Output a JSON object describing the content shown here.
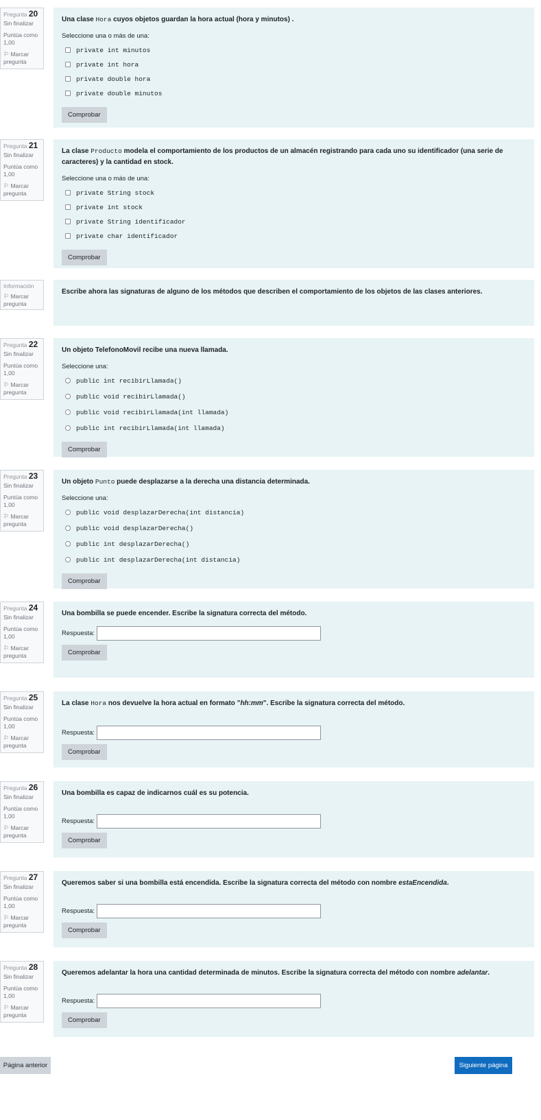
{
  "labels": {
    "pregunta": "Pregunta",
    "sin_finalizar": "Sin finalizar",
    "puntua_como": "Puntúa como",
    "puntos": "1,00",
    "marcar": "Marcar",
    "pregunta_lower": "pregunta",
    "informacion": "Información",
    "seleccione_varias": "Seleccione una o más de una:",
    "seleccione_una": "Seleccione una:",
    "comprobar": "Comprobar",
    "respuesta": "Respuesta:"
  },
  "q20": {
    "number": "20",
    "text_a": "Una clase ",
    "text_code": "Hora",
    "text_b": " cuyos objetos guardan la hora actual (hora y minutos) .",
    "options": [
      "private int minutos",
      "private int hora",
      "private double hora",
      "private double minutos"
    ]
  },
  "q21": {
    "number": "21",
    "text_a": "La clase ",
    "text_code": "Producto",
    "text_b": " modela el comportamiento de los productos de un almacén registrando para cada uno su identificador (una serie de caracteres) y la cantidad en stock.",
    "options": [
      "private String stock",
      "private int stock",
      "private String identificador",
      "private char identificador"
    ]
  },
  "info": {
    "text": "Escribe ahora las signaturas de alguno de los métodos que describen el comportamiento de los objetos de las clases anteriores."
  },
  "q22": {
    "number": "22",
    "text": "Un objeto TelefonoMovil recibe una nueva llamada.",
    "options": [
      "public int recibirLlamada()",
      "public void recibirLlamada()",
      "public void recibirLlamada(int llamada)",
      "public int recibirLlamada(int llamada)"
    ]
  },
  "q23": {
    "number": "23",
    "text_a": "Un objeto ",
    "text_code": "Punto",
    "text_b": " puede desplazarse a la derecha una distancia determinada.",
    "options": [
      "public void desplazarDerecha(int distancia)",
      "public void desplazarDerecha()",
      "public int desplazarDerecha()",
      "public int desplazarDerecha(int distancia)"
    ]
  },
  "q24": {
    "number": "24",
    "text": "Una bombilla se puede encender. Escribe la signatura correcta del método.",
    "answer": ""
  },
  "q25": {
    "number": "25",
    "text_a": "La clase ",
    "text_code": "Hora",
    "text_b": " nos devuelve la hora actual en formato \"",
    "text_italic": "hh:mm",
    "text_c": "\". Escribe la signatura correcta del método.",
    "answer": ""
  },
  "q26": {
    "number": "26",
    "text": "Una bombilla es capaz de indicarnos cuál es su potencia.",
    "answer": ""
  },
  "q27": {
    "number": "27",
    "text_a": "Queremos saber si una bombilla está encendida. Escribe la signatura correcta del método con nombre ",
    "text_italic": "estaEncendida",
    "text_b": ".",
    "answer": ""
  },
  "q28": {
    "number": "28",
    "text_a": "Queremos adelantar la hora una cantidad determinada de minutos. Escribe la signatura correcta del método con nombre ",
    "text_italic": "adelantar",
    "text_b": ".",
    "answer": ""
  },
  "nav": {
    "prev": "Página anterior",
    "next": "Siguiente página"
  },
  "colors": {
    "content_bg": "#e7f3f5",
    "button_gray": "#ced4da",
    "primary_blue": "#0f6cbf"
  }
}
